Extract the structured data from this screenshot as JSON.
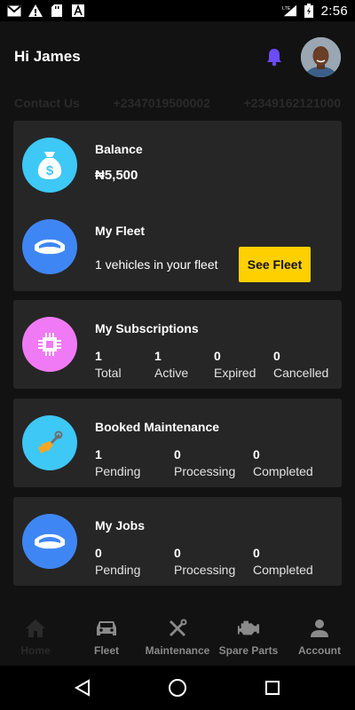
{
  "status_bar": {
    "time": "2:56",
    "network": "LTE",
    "icons": [
      "gmail-icon",
      "warning-icon",
      "sd-card-icon",
      "app-a-icon",
      "lte-signal-icon",
      "battery-icon"
    ]
  },
  "header": {
    "greeting": "Hi James",
    "bell_icon": "bell-icon",
    "accent_color": "#6c4cff"
  },
  "contact": {
    "label": "Contact Us",
    "phone1": "+2347019500002",
    "phone2": "+2349162121000"
  },
  "cards": {
    "balance": {
      "title": "Balance",
      "value": "₦5,500",
      "icon": "money-bag-icon",
      "icon_bg": "#3ec8f5"
    },
    "fleet": {
      "title": "My Fleet",
      "text": "1 vehicles in your fleet",
      "button_label": "See Fleet",
      "icon": "car-icon",
      "icon_bg": "#3f86f5"
    },
    "subscriptions": {
      "title": "My Subscriptions",
      "icon": "chip-icon",
      "icon_bg": "#f07af5",
      "stats": [
        {
          "value": "1",
          "label": "Total"
        },
        {
          "value": "1",
          "label": "Active"
        },
        {
          "value": "0",
          "label": "Expired"
        },
        {
          "value": "0",
          "label": "Cancelled"
        }
      ]
    },
    "maintenance": {
      "title": "Booked Maintenance",
      "icon": "wrench-icon",
      "icon_bg": "#3ec8f5",
      "stats": [
        {
          "value": "1",
          "label": "Pending"
        },
        {
          "value": "0",
          "label": "Processing"
        },
        {
          "value": "0",
          "label": "Completed"
        }
      ]
    },
    "jobs": {
      "title": "My Jobs",
      "icon": "car-icon",
      "icon_bg": "#3f86f5",
      "stats": [
        {
          "value": "0",
          "label": "Pending"
        },
        {
          "value": "0",
          "label": "Processing"
        },
        {
          "value": "0",
          "label": "Completed"
        }
      ]
    }
  },
  "bottom_nav": {
    "items": [
      {
        "label": "Home",
        "icon": "home-icon",
        "active": true
      },
      {
        "label": "Fleet",
        "icon": "car-front-icon",
        "active": false
      },
      {
        "label": "Maintenance",
        "icon": "tools-icon",
        "active": false
      },
      {
        "label": "Spare Parts",
        "icon": "engine-icon",
        "active": false
      },
      {
        "label": "Account",
        "icon": "person-icon",
        "active": false
      }
    ]
  },
  "colors": {
    "background": "#121212",
    "card": "#262626",
    "button_yellow": "#ffd000"
  }
}
